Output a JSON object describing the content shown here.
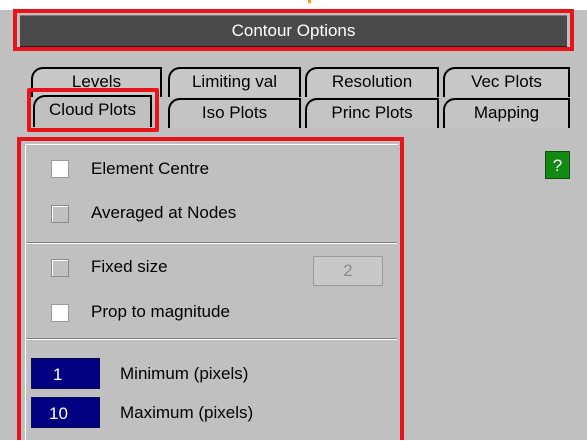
{
  "title": "Contour Options",
  "tabs_row1": [
    "Levels",
    "Limiting val",
    "Resolution",
    "Vec Plots"
  ],
  "tabs_row2": [
    "Cloud Plots",
    "Iso Plots",
    "Princ Plots",
    "Mapping"
  ],
  "selected_tab": "Cloud Plots",
  "help": "?",
  "options": {
    "element_centre": "Element Centre",
    "averaged_at_nodes": "Averaged at Nodes",
    "fixed_size": "Fixed size",
    "fixed_size_value": "2",
    "prop_to_magnitude": "Prop to magnitude"
  },
  "minimum": {
    "value": "1",
    "label": "Minimum (pixels)"
  },
  "maximum": {
    "value": "10",
    "label": "Maximum (pixels)"
  },
  "colors": {
    "highlight": "#e8141b",
    "title_bar": "#4a4a4a",
    "field": "#000080",
    "help": "#138a13",
    "panel": "#c0c0c0"
  }
}
